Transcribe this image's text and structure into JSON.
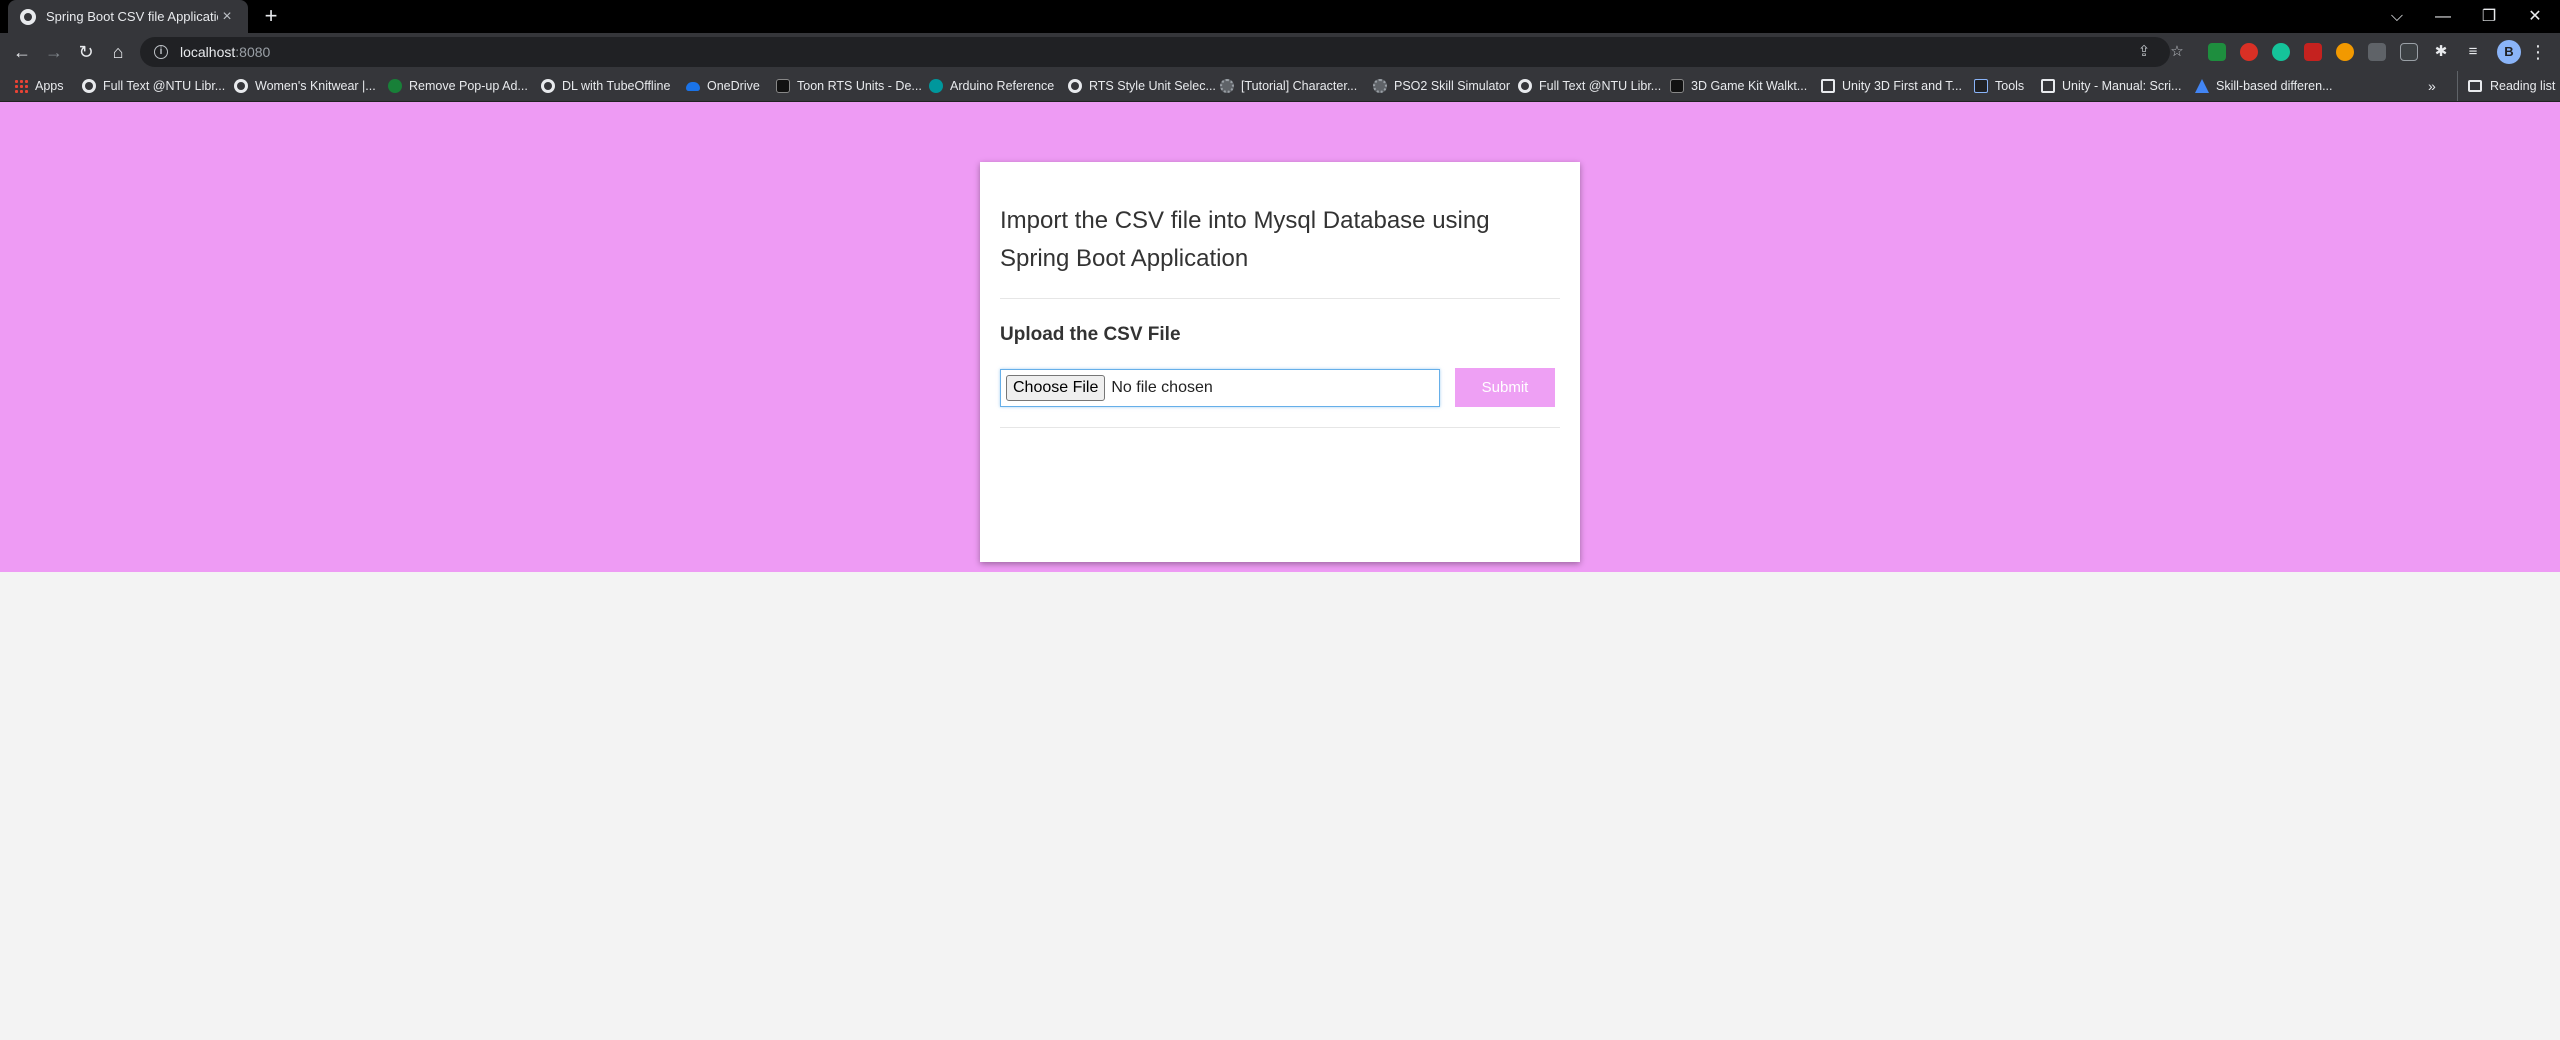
{
  "browser": {
    "tab": {
      "title": "Spring Boot CSV file Application",
      "close": "×"
    },
    "new_tab": "+",
    "window_controls": {
      "tabsearch": "⌵",
      "minimize": "—",
      "restore": "❐",
      "close": "✕"
    },
    "nav": {
      "back": "←",
      "forward": "→",
      "reload": "↻",
      "home": "⌂"
    },
    "address": {
      "host": "localhost",
      "port": ":8080",
      "info": "i"
    },
    "omnibox_icons": {
      "share": "⇪",
      "star": "☆"
    },
    "avatar_initial": "B",
    "menu": "⋮",
    "bookmarks": [
      {
        "label": "Apps",
        "icon": "apps-grid-icon"
      },
      {
        "label": "Full Text @NTU Libr...",
        "icon": "globe-icon"
      },
      {
        "label": "Women's Knitwear |...",
        "icon": "globe-icon"
      },
      {
        "label": "Remove Pop-up Ad...",
        "icon": "extension-icon"
      },
      {
        "label": "DL with TubeOffline",
        "icon": "globe-icon"
      },
      {
        "label": "OneDrive",
        "icon": "cloud-icon"
      },
      {
        "label": "Toon RTS Units - De...",
        "icon": "unity-icon"
      },
      {
        "label": "Arduino Reference",
        "icon": "arduino-icon"
      },
      {
        "label": "RTS Style Unit Selec...",
        "icon": "globe-icon"
      },
      {
        "label": "[Tutorial] Character...",
        "icon": "gear-icon"
      },
      {
        "label": "PSO2 Skill Simulator",
        "icon": "gear-icon"
      },
      {
        "label": "Full Text @NTU Libr...",
        "icon": "globe-icon"
      },
      {
        "label": "3D Game Kit Walkt...",
        "icon": "unity-icon"
      },
      {
        "label": "Unity 3D First and T...",
        "icon": "unity-frame-icon"
      },
      {
        "label": "Tools",
        "icon": "ntu-icon"
      },
      {
        "label": "Unity - Manual: Scri...",
        "icon": "unity-frame-icon"
      },
      {
        "label": "Skill-based differen...",
        "icon": "skill-icon"
      }
    ],
    "bookmarks_more": "»",
    "reading_list": "Reading list"
  },
  "page": {
    "title": "Import the CSV file into Mysql Database using Spring Boot Application",
    "upload_label": "Upload the CSV File",
    "file_button": "Choose File",
    "file_status": "No file chosen",
    "submit_label": "Submit"
  },
  "colors": {
    "hero_bg": "#ee9bf4",
    "page_bg": "#f3f3f3",
    "chrome_dark": "#35363a",
    "accent_focus": "#66afe9"
  }
}
